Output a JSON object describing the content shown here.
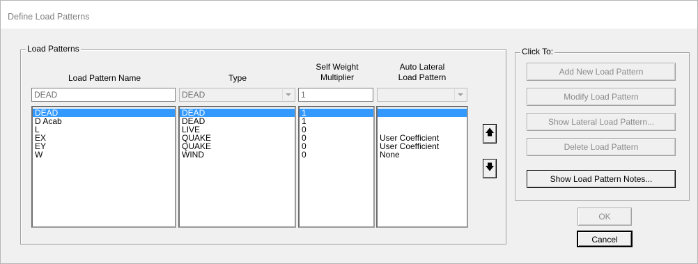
{
  "window": {
    "title": "Define Load Patterns"
  },
  "load_patterns": {
    "group_label": "Load Patterns",
    "columns": {
      "name": "Load Pattern Name",
      "type": "Type",
      "self_weight_line1": "Self Weight",
      "self_weight_line2": "Multiplier",
      "auto_lateral_line1": "Auto Lateral",
      "auto_lateral_line2": "Load Pattern"
    },
    "edit_row": {
      "name_value": "DEAD",
      "type_value": "DEAD",
      "multiplier_value": "1",
      "auto_lateral_value": ""
    },
    "rows": [
      {
        "name": "DEAD",
        "type": "DEAD",
        "multiplier": "1",
        "auto_lateral": ""
      },
      {
        "name": "D Acab",
        "type": "DEAD",
        "multiplier": "1",
        "auto_lateral": ""
      },
      {
        "name": "L",
        "type": "LIVE",
        "multiplier": "0",
        "auto_lateral": ""
      },
      {
        "name": "EX",
        "type": "QUAKE",
        "multiplier": "0",
        "auto_lateral": "User Coefficient"
      },
      {
        "name": "EY",
        "type": "QUAKE",
        "multiplier": "0",
        "auto_lateral": "User Coefficient"
      },
      {
        "name": "W",
        "type": "WIND",
        "multiplier": "0",
        "auto_lateral": "None"
      }
    ],
    "selected_index": 0,
    "move_up_icon": "arrow-up-icon",
    "move_down_icon": "arrow-down-icon"
  },
  "click_to": {
    "group_label": "Click To:",
    "buttons": {
      "add": "Add New Load Pattern",
      "modify": "Modify Load Pattern",
      "show_lateral": "Show Lateral Load Pattern...",
      "delete": "Delete Load Pattern",
      "notes": "Show Load Pattern Notes..."
    }
  },
  "dialog": {
    "ok_label": "OK",
    "cancel_label": "Cancel"
  },
  "colors": {
    "selection": "#3399ff",
    "face": "#f0f0f0",
    "disabled_text": "#8a8a8a"
  }
}
